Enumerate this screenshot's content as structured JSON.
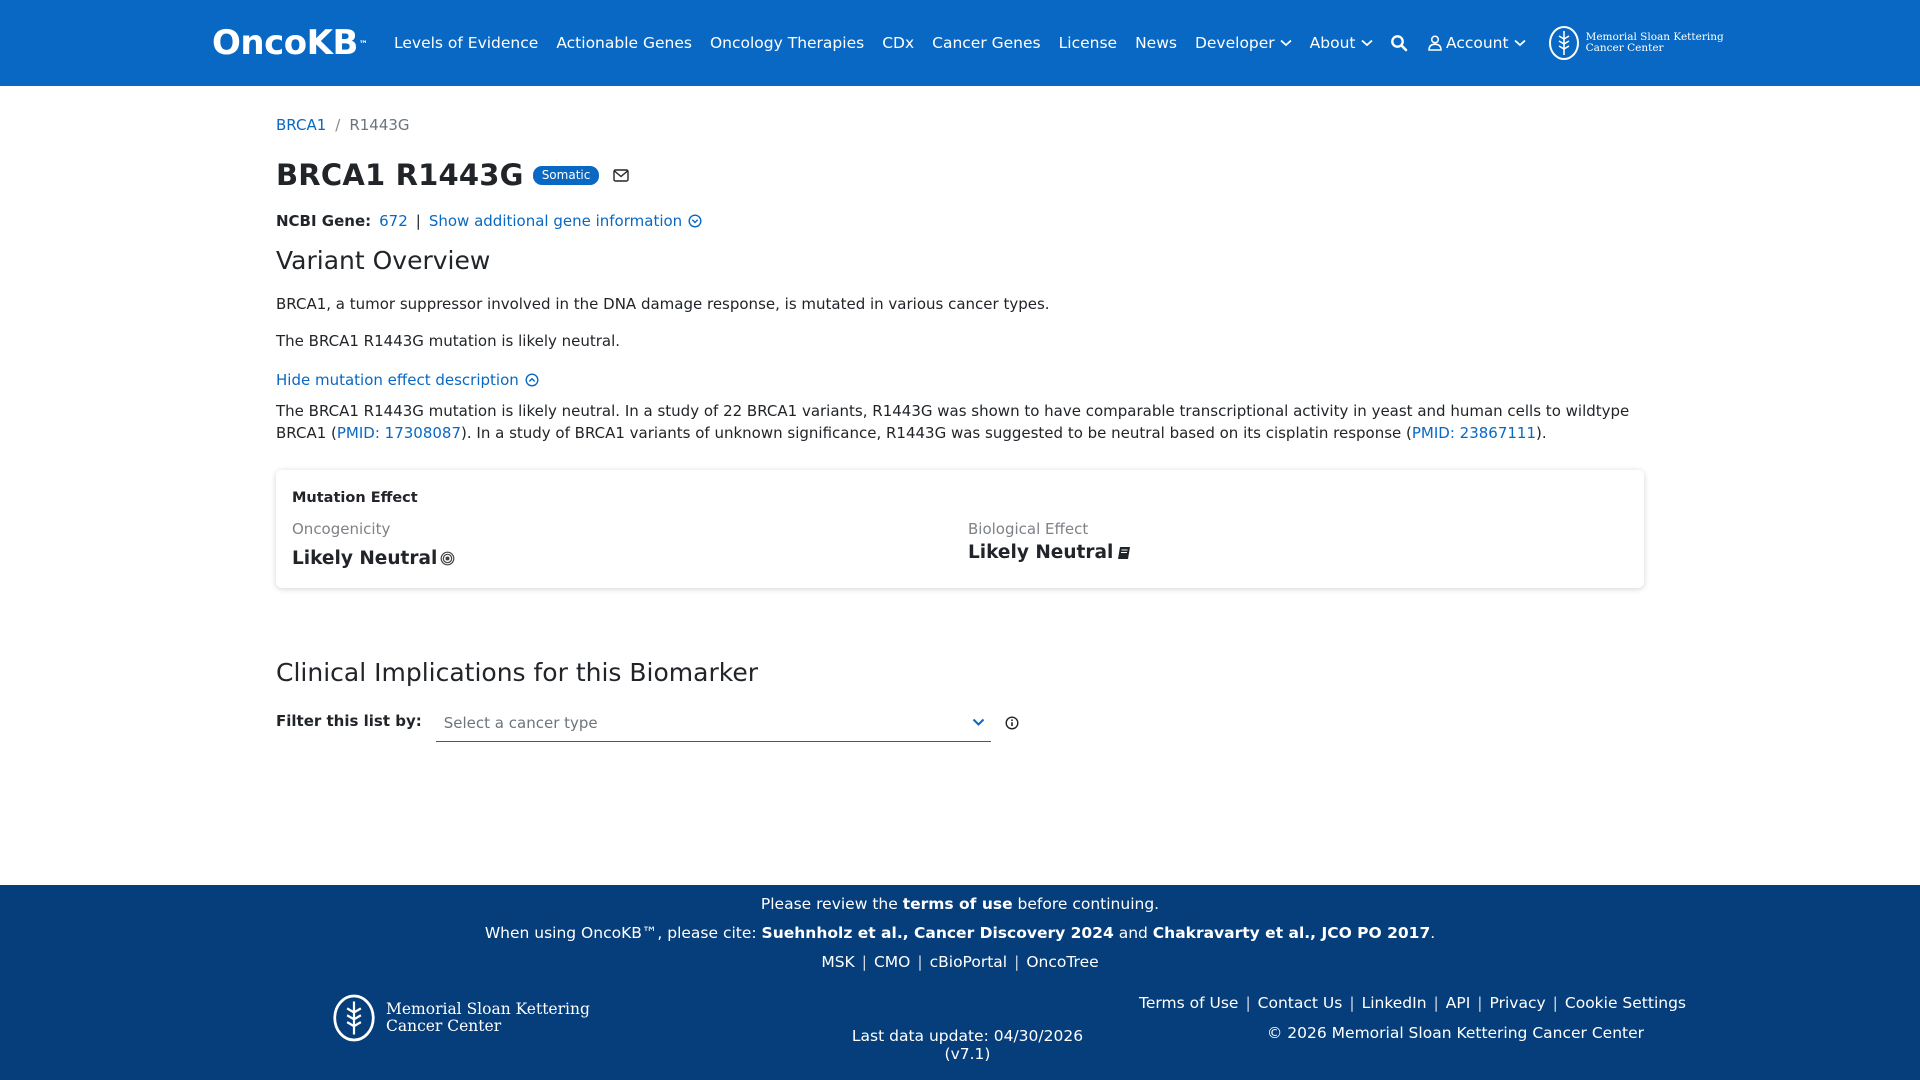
{
  "header": {
    "logo": "OncoKB",
    "logo_tm": "™",
    "nav": [
      {
        "label": "Levels of Evidence"
      },
      {
        "label": "Actionable Genes"
      },
      {
        "label": "Oncology Therapies"
      },
      {
        "label": "CDx"
      },
      {
        "label": "Cancer Genes"
      },
      {
        "label": "License"
      },
      {
        "label": "News"
      },
      {
        "label": "Developer"
      },
      {
        "label": "About"
      }
    ],
    "account_label": "Account",
    "msk_line1": "Memorial Sloan Kettering",
    "msk_line2": "Cancer Center"
  },
  "breadcrumb": {
    "gene": "BRCA1",
    "separator": "/",
    "current": "R1443G"
  },
  "page": {
    "title": "BRCA1 R1443G",
    "badge": "Somatic",
    "ncbi_label": "NCBI Gene:",
    "ncbi_value": "672",
    "ncbi_sep": "|",
    "show_more": "Show additional gene information"
  },
  "overview": {
    "heading": "Variant Overview",
    "summary1": "BRCA1, a tumor suppressor involved in the DNA damage response, is mutated in various cancer types.",
    "summary2": "The BRCA1 R1443G mutation is likely neutral.",
    "hide_link": "Hide mutation effect description",
    "desc_part1": "The BRCA1 R1443G mutation is likely neutral. In a study of 22 BRCA1 variants, R1443G was shown to have comparable transcriptional activity in yeast and human cells to wildtype BRCA1 (",
    "pmid1": "PMID: 17308087",
    "desc_part2": "). In a study of BRCA1 variants of unknown significance, R1443G was suggested to be neutral based on its cisplatin response (",
    "pmid2": "PMID: 23867111",
    "desc_part3": ")."
  },
  "mutation_effect": {
    "title": "Mutation Effect",
    "oncogenicity_label": "Oncogenicity",
    "oncogenicity_value": "Likely Neutral",
    "biological_label": "Biological Effect",
    "biological_value": "Likely Neutral"
  },
  "clinical": {
    "heading": "Clinical Implications for this Biomarker",
    "filter_label": "Filter this list by:",
    "select_placeholder": "Select a cancer type"
  },
  "footer": {
    "review_pre": "Please review the ",
    "review_link": "terms of use",
    "review_post": " before continuing.",
    "cite_pre": "When using OncoKB™, please cite: ",
    "cite1": "Suehnholz et al., Cancer Discovery 2024",
    "cite_and": " and ",
    "cite2": "Chakravarty et al., JCO PO 2017",
    "cite_end": ".",
    "links": [
      "MSK",
      "CMO",
      "cBioPortal",
      "OncoTree"
    ],
    "msk_line1": "Memorial Sloan Kettering",
    "msk_line2": "Cancer Center",
    "last_update": "Last data update: 04/30/2026 (v7.1)",
    "right_links": [
      "Terms of Use",
      "Contact Us",
      "LinkedIn",
      "API",
      "Privacy",
      "Cookie Settings"
    ],
    "copyright": "© 2026 Memorial Sloan Kettering Cancer Center"
  },
  "colors": {
    "brand_blue": "#0968c3",
    "footer_blue": "#053e7a"
  }
}
